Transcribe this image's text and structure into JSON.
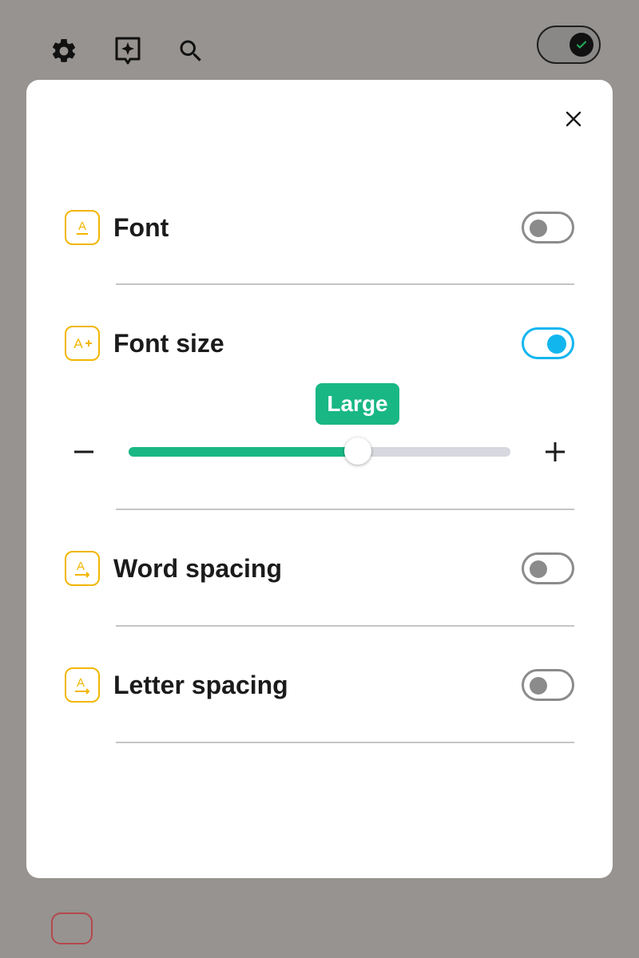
{
  "background": {
    "toolbar_icons": [
      "gear-icon",
      "sparkle-bookmark-icon",
      "search-icon"
    ],
    "mode_toggle": {
      "on": true
    }
  },
  "modal": {
    "close_icon": "close-icon",
    "settings": [
      {
        "id": "font",
        "label": "Font",
        "icon": "font-icon",
        "enabled": false
      },
      {
        "id": "font-size",
        "label": "Font size",
        "icon": "font-size-increase-icon",
        "enabled": true
      },
      {
        "id": "word-spacing",
        "label": "Word spacing",
        "icon": "word-spacing-icon",
        "enabled": false
      },
      {
        "id": "letter-spacing",
        "label": "Letter spacing",
        "icon": "letter-spacing-icon",
        "enabled": false
      }
    ],
    "font_size_slider": {
      "value_label": "Large",
      "level_fraction": 0.6,
      "decrease_symbol": "−",
      "increase_symbol": "+"
    }
  },
  "colors": {
    "accent_icon": "#f2b600",
    "toggle_on": "#12b6ef",
    "slider_fill": "#19b784"
  }
}
